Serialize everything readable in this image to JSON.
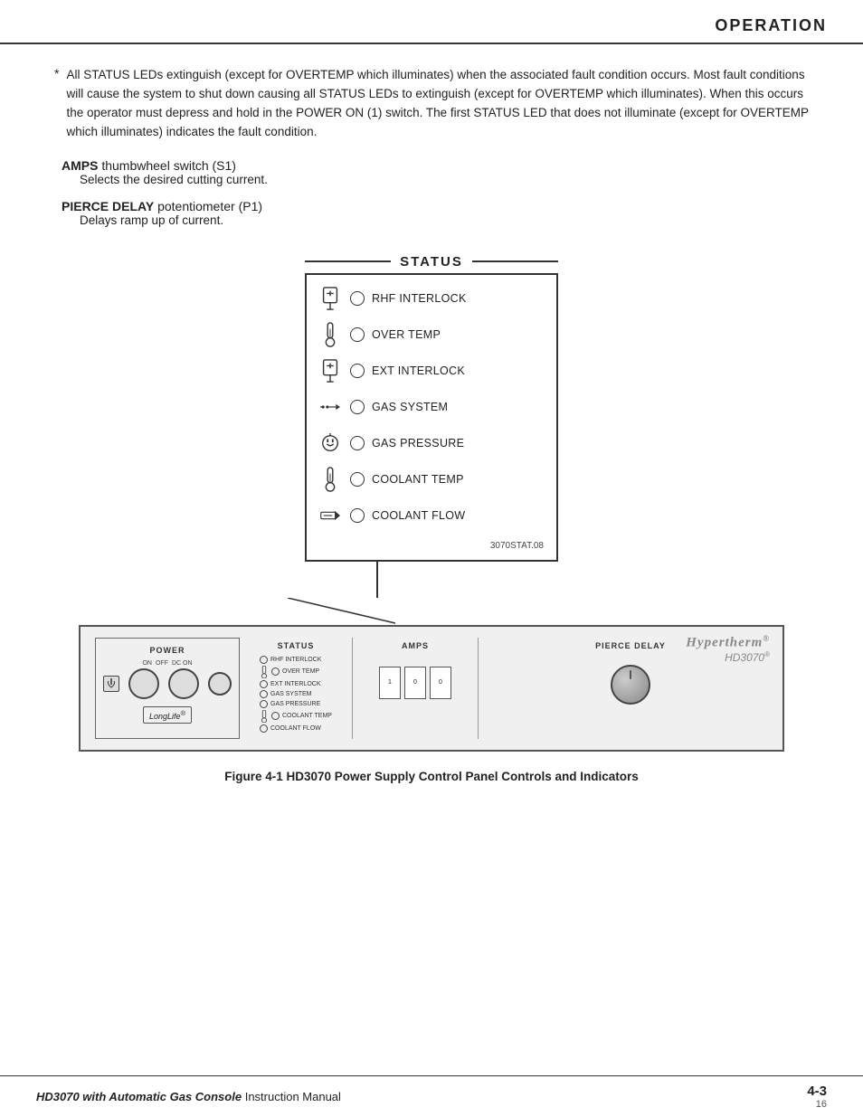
{
  "header": {
    "title": "OPERATION"
  },
  "body": {
    "bullet": {
      "star": "*",
      "text": "All STATUS LEDs extinguish (except for OVERTEMP which illuminates) when the associated fault condition occurs. Most fault conditions will cause the system to shut down causing all STATUS LEDs to extinguish  (except for OVERTEMP which illuminates). When this occurs the operator must depress and hold in the POWER ON (1) switch. The first STATUS LED that does not illuminate (except for OVERTEMP which  illuminates) indicates the fault condition."
    },
    "amps_section": {
      "label": "AMPS",
      "rest": " thumbwheel switch (S1)",
      "desc": "Selects the desired cutting current."
    },
    "pierce_section": {
      "label": "PIERCE DELAY",
      "rest": " potentiometer (P1)",
      "desc": "Delays ramp up of current."
    }
  },
  "status_diagram": {
    "header": "STATUS",
    "rows": [
      {
        "label": "RHF INTERLOCK",
        "icon_type": "rhf"
      },
      {
        "label": "OVER TEMP",
        "icon_type": "thermo"
      },
      {
        "label": "EXT INTERLOCK",
        "icon_type": "rhf"
      },
      {
        "label": "GAS SYSTEM",
        "icon_type": "arrow_right"
      },
      {
        "label": "GAS PRESSURE",
        "icon_type": "plug"
      },
      {
        "label": "COOLANT TEMP",
        "icon_type": "thermo"
      },
      {
        "label": "COOLANT FLOW",
        "icon_type": "arrow_flow"
      }
    ],
    "part_number": "3070STAT.08"
  },
  "panel": {
    "brand_name": "Hypertherm®",
    "brand_model": "HD3070®",
    "power_label": "POWER",
    "status_label": "STATUS",
    "amps_label": "AMPS",
    "pierce_label": "PIERCE DELAY",
    "longlife": "LongLife®",
    "power_sub": {
      "on": "ON",
      "off": "OFF",
      "dc": "DC ON"
    },
    "mini_status": [
      "RHF INTERLOCK",
      "OVER TEMP",
      "EXT INTERLOCK",
      "GAS SYSTEM",
      "GAS PRESSURE",
      "COOLANT TEMP",
      "COOLANT FLOW"
    ]
  },
  "figure_caption": "Figure 4-1    HD3070 Power Supply Control Panel Controls and Indicators",
  "footer": {
    "left_italic": "HD3070 with Automatic Gas Console",
    "left_rest": "  Instruction Manual",
    "page": "4-3",
    "sub": "16"
  }
}
